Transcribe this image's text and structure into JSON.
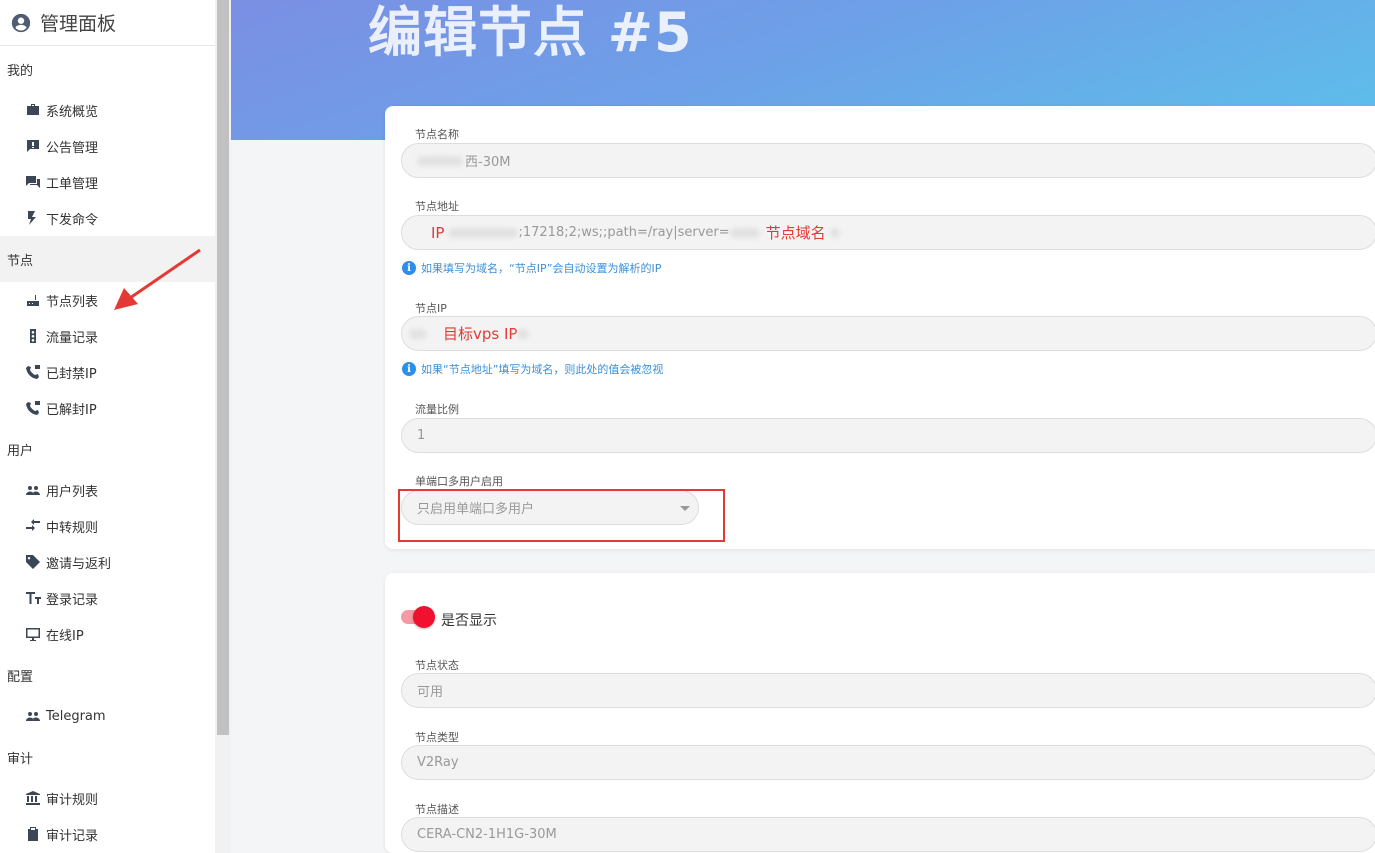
{
  "sidebar": {
    "title": "管理面板",
    "sections": [
      {
        "label": "我的",
        "items": [
          {
            "label": "系统概览",
            "icon": "briefcase-icon"
          },
          {
            "label": "公告管理",
            "icon": "announcement-icon"
          },
          {
            "label": "工单管理",
            "icon": "chat-icon"
          },
          {
            "label": "下发命令",
            "icon": "command-icon"
          }
        ]
      },
      {
        "label": "节点",
        "items": [
          {
            "label": "节点列表",
            "icon": "router-icon"
          },
          {
            "label": "流量记录",
            "icon": "traffic-light-icon"
          },
          {
            "label": "已封禁IP",
            "icon": "sip-phone-icon"
          },
          {
            "label": "已解封IP",
            "icon": "sip-phone-icon"
          }
        ]
      },
      {
        "label": "用户",
        "items": [
          {
            "label": "用户列表",
            "icon": "people-icon"
          },
          {
            "label": "中转规则",
            "icon": "transfer-icon"
          },
          {
            "label": "邀请与返利",
            "icon": "tag-icon"
          },
          {
            "label": "登录记录",
            "icon": "text-size-icon"
          },
          {
            "label": "在线IP",
            "icon": "monitor-icon"
          }
        ]
      },
      {
        "label": "配置",
        "items": [
          {
            "label": "Telegram",
            "icon": "people-icon"
          }
        ]
      },
      {
        "label": "审计",
        "items": [
          {
            "label": "审计规则",
            "icon": "bank-icon"
          },
          {
            "label": "审计记录",
            "icon": "clipboard-icon"
          }
        ]
      }
    ]
  },
  "page": {
    "title": "编辑节点 #5"
  },
  "form": {
    "name_label": "节点名称",
    "name_value": "西-30M",
    "address_label": "节点地址",
    "address_value": ";17218;2;ws;;path=/ray|server=",
    "address_anno_ip": "IP",
    "address_anno_domain": "节点域名",
    "address_hint": "如果填写为域名，“节点IP”会自动设置为解析的IP",
    "ip_label": "节点IP",
    "ip_anno": "目标vps IP",
    "ip_hint": "如果“节点地址”填写为域名，则此处的值会被忽视",
    "ratio_label": "流量比例",
    "ratio_value": "1",
    "multi_label": "单端口多用户启用",
    "multi_value": "只启用单端口多用户",
    "show_label": "是否显示",
    "status_label": "节点状态",
    "status_value": "可用",
    "type_label": "节点类型",
    "type_value": "V2Ray",
    "desc_label": "节点描述",
    "desc_value": "CERA-CN2-1H1G-30M"
  },
  "colors": {
    "accent": "#f0102f",
    "annotation": "#e53935",
    "hint": "#3b8fd6"
  }
}
